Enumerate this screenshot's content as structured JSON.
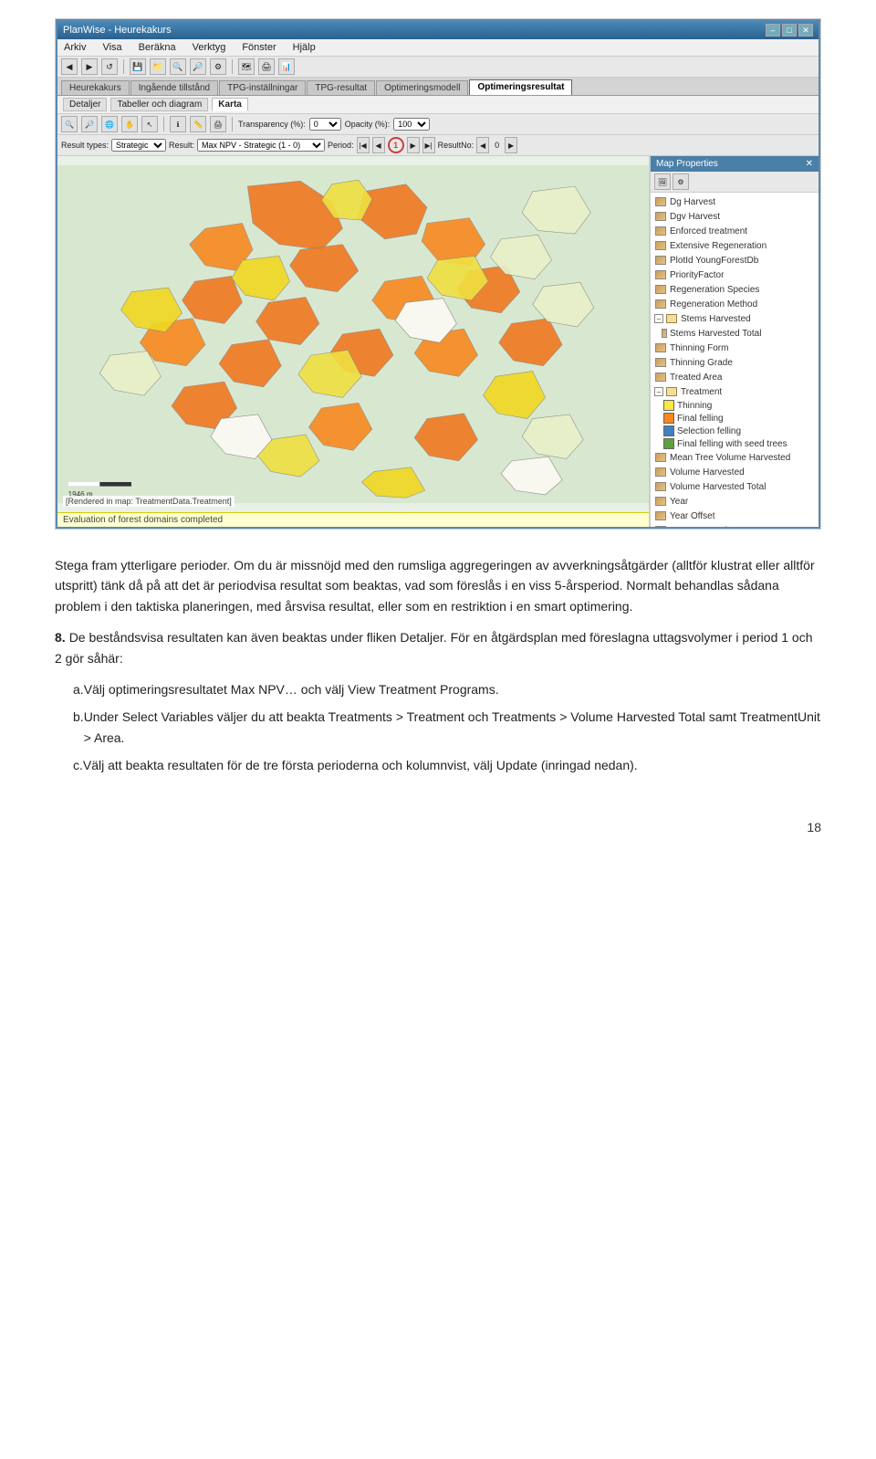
{
  "app": {
    "title": "PlanWise - Heurekakurs",
    "window_controls": [
      "–",
      "□",
      "✕"
    ]
  },
  "menu": {
    "items": [
      "Arkiv",
      "Visa",
      "Beräkna",
      "Verktyg",
      "Fönster",
      "Hjälp"
    ]
  },
  "tabs": {
    "items": [
      "Heurekakurs",
      "Ingående tillstånd",
      "TPG-inställningar",
      "TPG-resultat",
      "Optimeringsmodell",
      "Optimeringsresultat"
    ],
    "active_index": 5
  },
  "sub_tabs": {
    "items": [
      "Detaljer",
      "Tabeller och diagram",
      "Karta"
    ],
    "active_index": 2
  },
  "map_controls": {
    "transparency_label": "Transparency (%):",
    "transparency_value": "0",
    "opacity_label": "Opacity (%):",
    "opacity_value": "100",
    "result_types_label": "Result types:",
    "result_types_value": "Strategic",
    "result_label": "Result:",
    "result_value": "Max NPV - Strategic (1 - 0)",
    "period_label": "Period:",
    "period_value": "1",
    "result_no_label": "ResultNo:",
    "result_no_value": "0"
  },
  "scale": {
    "value": "1946 m"
  },
  "map_rendered_text": "[Rendered in map: TreatmentData.Treatment]",
  "eval_text": "Evaluation of forest domains completed",
  "map_properties": {
    "title": "Map Properties",
    "tree_items": [
      {
        "label": "Dg Harvest",
        "indent": 0,
        "type": "layer"
      },
      {
        "label": "Dgv Harvest",
        "indent": 0,
        "type": "layer"
      },
      {
        "label": "Enforced treatment",
        "indent": 0,
        "type": "layer"
      },
      {
        "label": "Extensive Regeneration",
        "indent": 0,
        "type": "layer"
      },
      {
        "label": "PlotId YoungForestDb",
        "indent": 0,
        "type": "layer"
      },
      {
        "label": "PriorityFactor",
        "indent": 0,
        "type": "layer"
      },
      {
        "label": "Regeneration Species",
        "indent": 0,
        "type": "layer"
      },
      {
        "label": "Regeneration Method",
        "indent": 0,
        "type": "layer"
      },
      {
        "label": "Stems Harvested",
        "indent": 0,
        "type": "group_open"
      },
      {
        "label": "Stems Harvested Total",
        "indent": 0,
        "type": "layer"
      },
      {
        "label": "Thinning Form",
        "indent": 0,
        "type": "layer"
      },
      {
        "label": "Thinning Grade",
        "indent": 0,
        "type": "layer"
      },
      {
        "label": "Treated Area",
        "indent": 0,
        "type": "layer"
      },
      {
        "label": "Treatment",
        "indent": 0,
        "type": "group_open"
      },
      {
        "label": "Thinning",
        "indent": 1,
        "type": "legend_yellow"
      },
      {
        "label": "Final felling",
        "indent": 1,
        "type": "legend_orange"
      },
      {
        "label": "Selection felling",
        "indent": 1,
        "type": "legend_blue"
      },
      {
        "label": "Final felling with seed trees",
        "indent": 1,
        "type": "legend_green"
      },
      {
        "label": "Mean Tree Volume Harvested",
        "indent": 0,
        "type": "layer"
      },
      {
        "label": "Volume Harvested",
        "indent": 0,
        "type": "layer"
      },
      {
        "label": "Volume Harvested Total",
        "indent": 0,
        "type": "layer"
      },
      {
        "label": "Year",
        "indent": 0,
        "type": "layer"
      },
      {
        "label": "Year Offset",
        "indent": 0,
        "type": "layer"
      },
      {
        "label": "Treatment Unit",
        "indent": 0,
        "type": "layer"
      }
    ]
  },
  "body": {
    "paragraph1": "Stega fram ytterligare perioder. Om du är missnöjd med den rumsliga aggregeringen av avverkningsåtgärder (alltför klustrat eller alltför utspritt) tänk då på att det är periodvisa resultat som beaktas, vad som föreslås i en viss 5-årsperiod. Normalt behandlas sådana problem i den taktiska planeringen, med årsvisa resultat, eller som en restriktion i en smart optimering.",
    "section_number": "8.",
    "section_text": "De beståndsvisa resultaten kan även beaktas under fliken Detaljer. För en åtgärdsplan med föreslagna uttagsvolymer i period 1 och 2 gör såhär:",
    "list_items": [
      {
        "letter": "a.",
        "text": "Välj optimeringsresultatet Max NPV… och välj View Treatment Programs."
      },
      {
        "letter": "b.",
        "text": "Under Select Variables väljer du att beakta Treatments > Treatment och Treatments > Volume Harvested Total samt TreatmentUnit > Area."
      },
      {
        "letter": "c.",
        "text": "Välj att beakta resultaten för de tre första perioderna och kolumnvist, välj Update (inringad nedan)."
      }
    ],
    "page_number": "18"
  }
}
